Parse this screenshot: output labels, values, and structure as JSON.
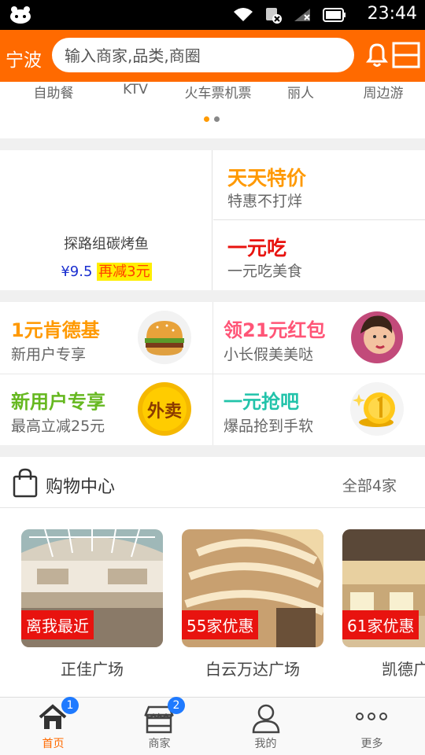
{
  "status_bar": {
    "time": "23:44"
  },
  "header": {
    "city": "宁波",
    "search_placeholder": "输入商家,品类,商圈"
  },
  "categories": [
    "自助餐",
    "KTV",
    "火车票机票",
    "丽人",
    "周边游"
  ],
  "promo": {
    "left": {
      "name": "探路组碳烤鱼",
      "price": "¥9.5",
      "discount": "再减3元"
    },
    "right_top": {
      "title": "天天特价",
      "subtitle": "特惠不打烊",
      "color": "#ff9900"
    },
    "right_bottom": {
      "title": "一元吃",
      "subtitle": "一元吃美食",
      "color": "#e8130f"
    }
  },
  "deals": [
    {
      "title": "1元肯德基",
      "subtitle": "新用户专享",
      "color": "#ff9900",
      "icon": "burger-icon"
    },
    {
      "title": "领21元红包",
      "subtitle": "小长假美美哒",
      "color": "#ff5577",
      "icon": "beauty-icon"
    },
    {
      "title": "新用户专享",
      "subtitle": "最高立减25元",
      "color": "#66b820",
      "icon": "takeout-icon",
      "icon_text": "外卖"
    },
    {
      "title": "一元抢吧",
      "subtitle": "爆品抢到手软",
      "color": "#22c3aa",
      "icon": "coin-icon"
    }
  ],
  "shopping": {
    "title": "购物中心",
    "all": "全部4家"
  },
  "malls": [
    {
      "name": "正佳广场",
      "tag": "离我最近"
    },
    {
      "name": "白云万达广场",
      "tag": "55家优惠"
    },
    {
      "name": "凯德广场",
      "tag": "61家优惠"
    }
  ],
  "tabs": [
    {
      "label": "首页",
      "badge": "1"
    },
    {
      "label": "商家",
      "badge": "2"
    },
    {
      "label": "我的"
    },
    {
      "label": "更多"
    }
  ],
  "colors": {
    "brand": "#ff6a00",
    "badge": "#1f7aff"
  }
}
